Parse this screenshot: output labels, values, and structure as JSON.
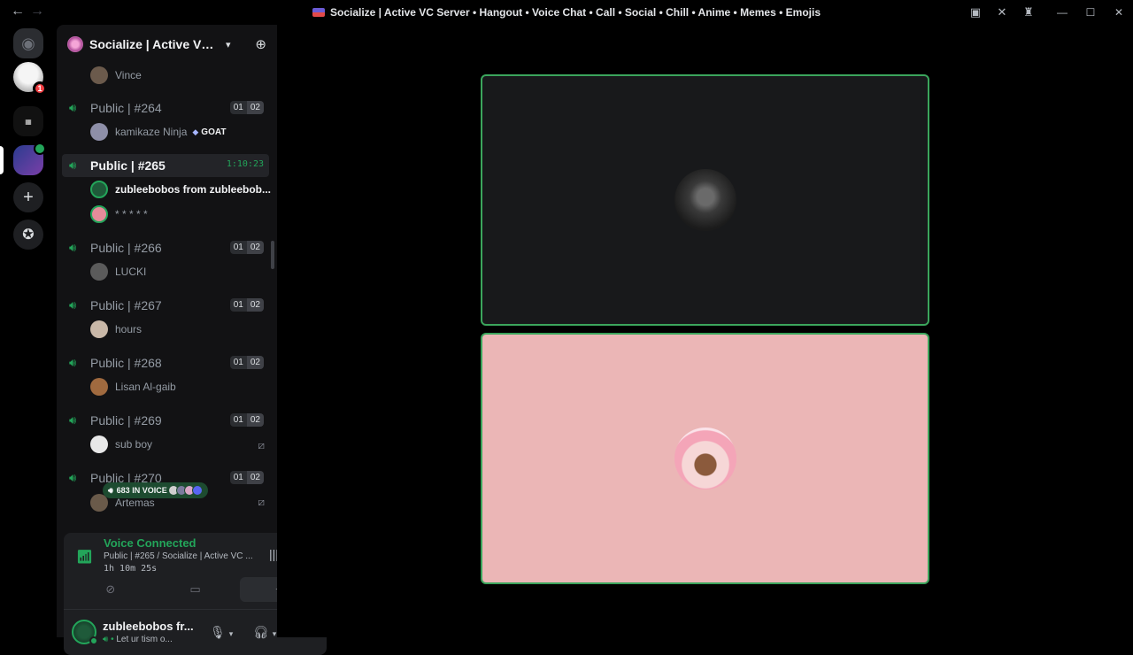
{
  "window": {
    "title": "Socialize | Active VC Server • Hangout • Voice Chat • Call • Social • Chill • Anime • Memes • Emojis"
  },
  "guild": {
    "name": "Socialize | Active VC S..."
  },
  "servers": {
    "dm_badge": "1"
  },
  "channels_list": {
    "top_member": "Vince",
    "ch264": {
      "name": "Public | #264",
      "limit_a": "01",
      "limit_b": "02",
      "member": "kamikaze Ninja",
      "tag": "GOAT"
    },
    "ch265": {
      "name": "Public | #265",
      "timer": "1:10:23",
      "member1": "zubleebobos from zubleebob...",
      "member2": "* * * * *"
    },
    "ch266": {
      "name": "Public | #266",
      "limit_a": "01",
      "limit_b": "02",
      "member": "LUCKI"
    },
    "ch267": {
      "name": "Public | #267",
      "limit_a": "01",
      "limit_b": "02",
      "member": "hours"
    },
    "ch268": {
      "name": "Public | #268",
      "limit_a": "01",
      "limit_b": "02",
      "member": "Lisan Al-gaib"
    },
    "ch269": {
      "name": "Public | #269",
      "limit_a": "01",
      "limit_b": "02",
      "member": "sub boy"
    },
    "ch270": {
      "name": "Public | #270",
      "limit_a": "01",
      "limit_b": "02",
      "member": "Artemas"
    }
  },
  "voice_chip": {
    "label": "683 IN VOICE"
  },
  "voice_panel": {
    "status": "Voice Connected",
    "channel": "Public | #265 / Socialize | Active VC ...",
    "elapsed": "1h 10m 25s"
  },
  "user": {
    "name": "zubleebobos fr...",
    "status": "Let ur tism o..."
  },
  "colors": {
    "accent_green": "#23a55a",
    "tile_border": "#3ba55c",
    "tile2_bg": "#ebb6b6"
  }
}
